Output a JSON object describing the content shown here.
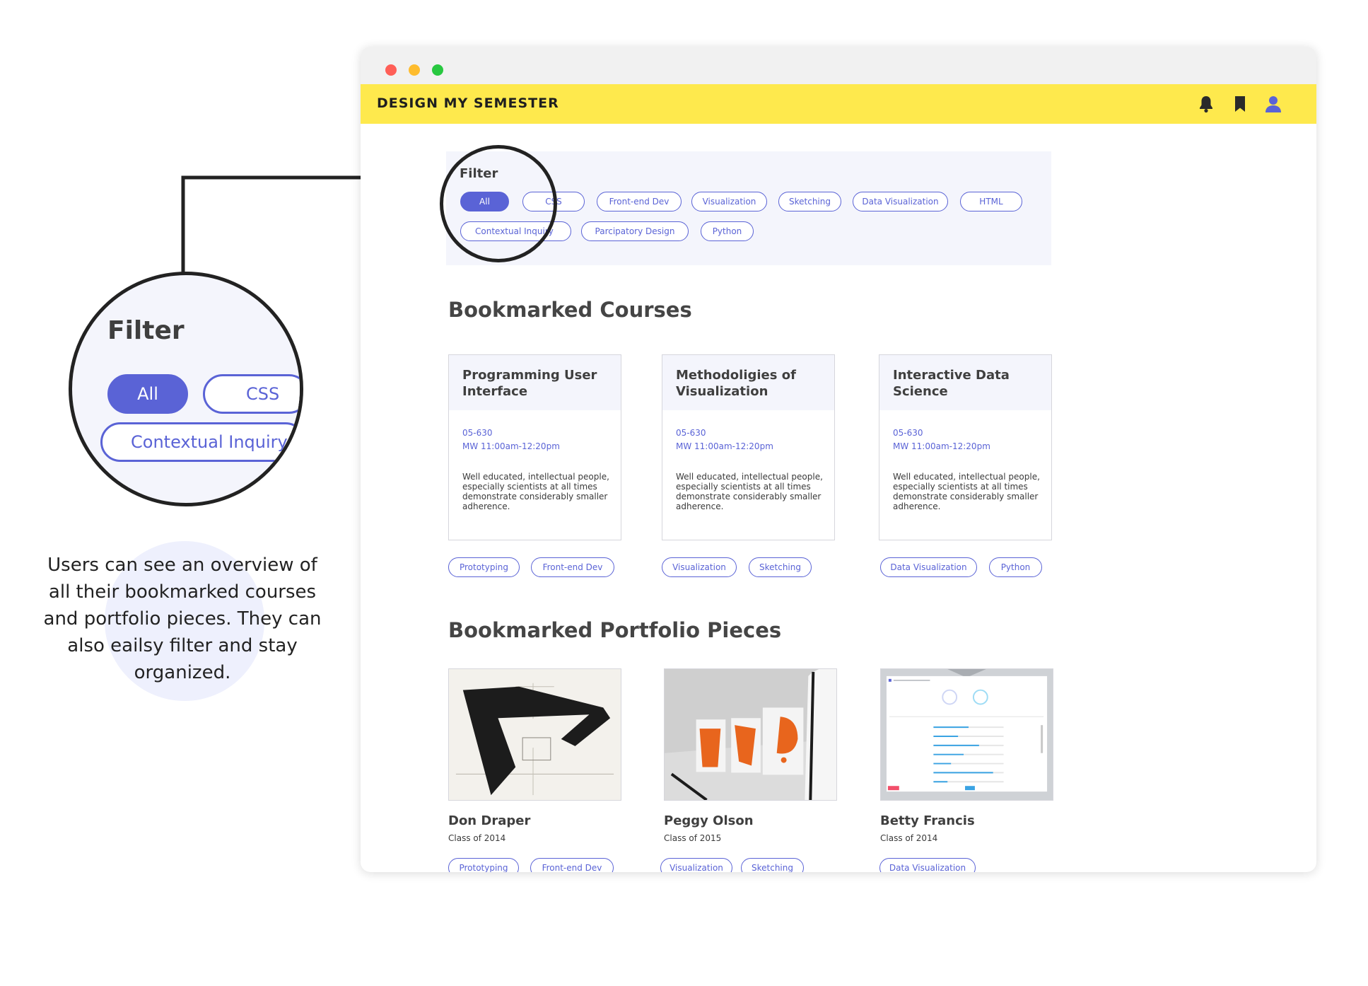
{
  "app": {
    "title": "DESIGN MY SEMESTER"
  },
  "header_icons": [
    "bell-icon",
    "bookmark-icon",
    "user-icon"
  ],
  "colors": {
    "accent": "#5a63d6",
    "brand_bar": "#fee94d",
    "panel": "#f4f5fc"
  },
  "filter": {
    "title": "Filter",
    "chips": [
      {
        "label": "All",
        "active": true
      },
      {
        "label": "CSS"
      },
      {
        "label": "Front-end Dev"
      },
      {
        "label": "Visualization"
      },
      {
        "label": "Sketching"
      },
      {
        "label": "Data Visualization"
      },
      {
        "label": "HTML"
      },
      {
        "label": "Contextual Inquiry"
      },
      {
        "label": "Parcipatory Design"
      },
      {
        "label": "Python"
      }
    ]
  },
  "courses": {
    "heading": "Bookmarked Courses",
    "items": [
      {
        "title": "Programming User Interface",
        "code": "05-630",
        "time": "MW 11:00am-12:20pm",
        "description": "Well educated, intellectual people, especially scientists at all times demonstrate considerably smaller adherence.",
        "tags": [
          "Prototyping",
          "Front-end Dev"
        ]
      },
      {
        "title": "Methodoligies of Visualization",
        "code": "05-630",
        "time": "MW 11:00am-12:20pm",
        "description": "Well educated, intellectual people, especially scientists at all times demonstrate considerably smaller adherence.",
        "tags": [
          "Visualization",
          "Sketching"
        ]
      },
      {
        "title": "Interactive Data Science",
        "code": "05-630",
        "time": "MW 11:00am-12:20pm",
        "description": "Well educated, intellectual people, especially scientists at all times demonstrate considerably smaller adherence.",
        "tags": [
          "Data Visualization",
          "Python"
        ]
      }
    ]
  },
  "portfolio": {
    "heading": "Bookmarked Portfolio Pieces",
    "items": [
      {
        "name": "Don Draper",
        "class": "Class of 2014",
        "tags": [
          "Prototyping",
          "Front-end Dev"
        ]
      },
      {
        "name": "Peggy Olson",
        "class": "Class of 2015",
        "tags": [
          "Visualization",
          "Sketching"
        ]
      },
      {
        "name": "Betty Francis",
        "class": "Class of 2014",
        "tags": [
          "Data Visualization"
        ]
      }
    ]
  },
  "callout": {
    "zoom_title": "Filter",
    "zoom_chips": [
      "All",
      "CSS",
      "Contextual Inquiry"
    ],
    "caption": "Users can see an overview of all their bookmarked courses and portfolio pieces. They can also eailsy filter and stay organized."
  }
}
